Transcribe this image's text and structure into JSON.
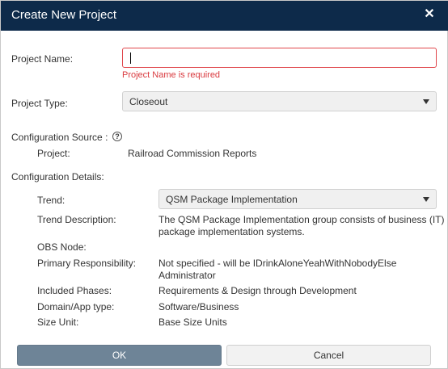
{
  "dialog": {
    "title": "Create New Project",
    "close_glyph": "✕"
  },
  "form": {
    "project_name": {
      "label": "Project Name:",
      "value": "",
      "error": "Project Name is required"
    },
    "project_type": {
      "label": "Project Type:",
      "value": "Closeout"
    },
    "configuration_source": {
      "label": "Configuration Source :",
      "help_glyph": "?",
      "project_label": "Project:",
      "project_value": "Railroad Commission Reports"
    },
    "configuration_details": {
      "label": "Configuration Details:",
      "trend_label": "Trend:",
      "trend_value": "QSM Package Implementation",
      "trend_description_label": "Trend Description:",
      "trend_description_line1": "The QSM Package Implementation group consists of business (IT)",
      "trend_description_line2": "package implementation systems.",
      "obs_node_label": "OBS Node:",
      "obs_node_value": "",
      "primary_responsibility_label": "Primary Responsibility:",
      "primary_responsibility_line1": "Not specified - will be IDrinkAloneYeahWithNobodyElse",
      "primary_responsibility_line2": "Administrator",
      "included_phases_label": "Included Phases:",
      "included_phases_value": "Requirements & Design through Development",
      "domain_label": "Domain/App type:",
      "domain_value": "Software/Business",
      "size_unit_label": "Size Unit:",
      "size_unit_value": "Base Size Units"
    }
  },
  "buttons": {
    "ok_label": "OK",
    "cancel_label": "Cancel"
  },
  "colors": {
    "titlebar": "#0d2a4a",
    "error": "#d9393e",
    "ok_button": "#6e8497"
  }
}
